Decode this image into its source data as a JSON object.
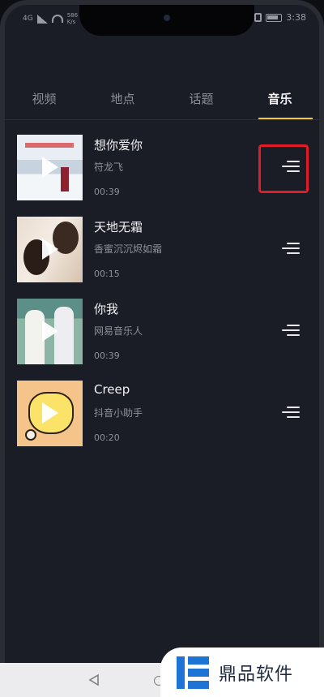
{
  "status_bar": {
    "network": "4G",
    "speed_value": "586",
    "speed_unit": "K/s",
    "time": "3:38"
  },
  "tabs": [
    {
      "label": "视频",
      "active": false
    },
    {
      "label": "地点",
      "active": false
    },
    {
      "label": "话题",
      "active": false
    },
    {
      "label": "音乐",
      "active": true
    }
  ],
  "songs": [
    {
      "title": "想你爱你",
      "artist": "符龙飞",
      "duration": "00:39",
      "cover_icon": "snow-scene-cover",
      "highlighted": true
    },
    {
      "title": "天地无霜",
      "artist": "香蜜沉沉烬如霜",
      "duration": "00:15",
      "cover_icon": "couple-drama-cover",
      "highlighted": false
    },
    {
      "title": "你我",
      "artist": "网易音乐人",
      "duration": "00:39",
      "cover_icon": "two-people-cover",
      "highlighted": false
    },
    {
      "title": "Creep",
      "artist": "抖音小助手",
      "duration": "00:20",
      "cover_icon": "yellow-cat-cartoon-cover",
      "highlighted": false
    }
  ],
  "icons": {
    "play": "play-icon",
    "menu": "song-menu-icon",
    "back": "back-icon",
    "home": "home-icon"
  },
  "colors": {
    "accent": "#f3c63a",
    "highlight": "#e01c28",
    "background": "#1b1d26"
  },
  "watermark": {
    "text": "鼎品软件"
  }
}
